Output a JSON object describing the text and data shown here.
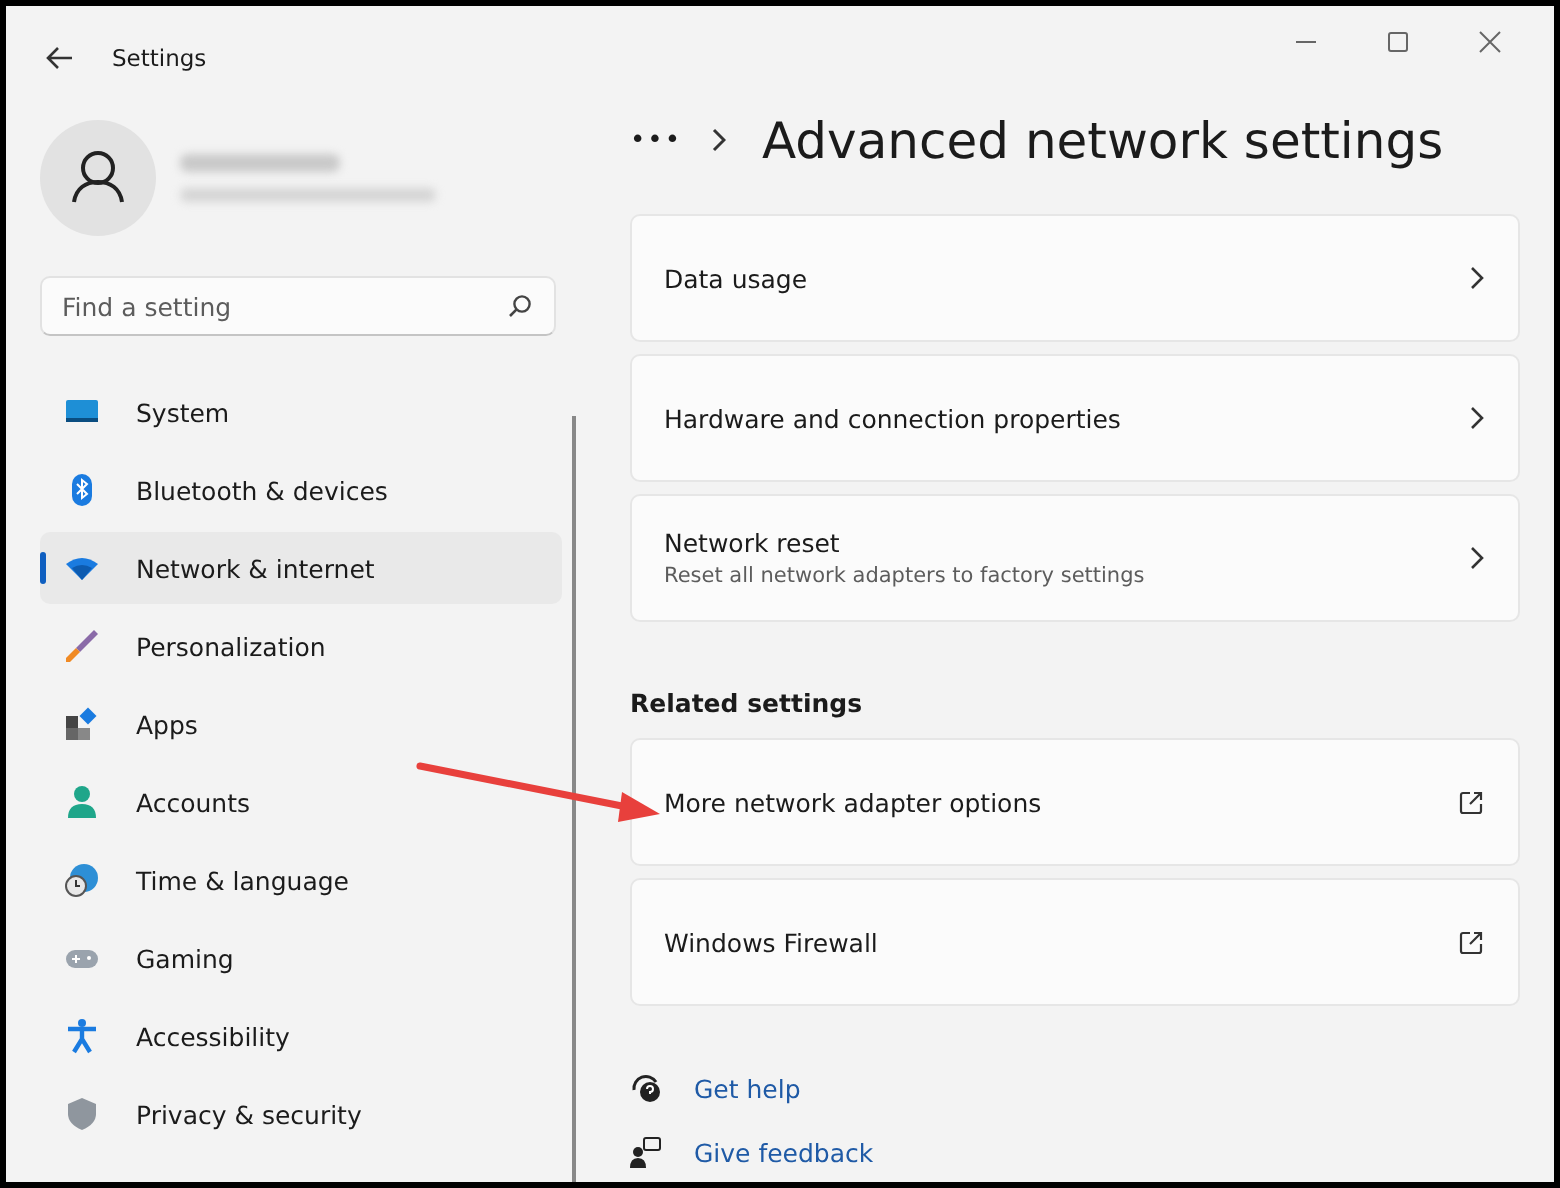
{
  "window": {
    "title": "Settings"
  },
  "search": {
    "placeholder": "Find a setting"
  },
  "sidebar": {
    "items": [
      {
        "label": "System",
        "selected": false
      },
      {
        "label": "Bluetooth & devices",
        "selected": false
      },
      {
        "label": "Network & internet",
        "selected": true
      },
      {
        "label": "Personalization",
        "selected": false
      },
      {
        "label": "Apps",
        "selected": false
      },
      {
        "label": "Accounts",
        "selected": false
      },
      {
        "label": "Time & language",
        "selected": false
      },
      {
        "label": "Gaming",
        "selected": false
      },
      {
        "label": "Accessibility",
        "selected": false
      },
      {
        "label": "Privacy & security",
        "selected": false
      }
    ]
  },
  "breadcrumb": {
    "overflow": "•••",
    "title": "Advanced network settings"
  },
  "cards": [
    {
      "title": "Data usage",
      "kind": "chevron"
    },
    {
      "title": "Hardware and connection properties",
      "kind": "chevron"
    },
    {
      "title": "Network reset",
      "subtitle": "Reset all network adapters to factory settings",
      "kind": "chevron"
    }
  ],
  "related": {
    "heading": "Related settings",
    "cards": [
      {
        "title": "More network adapter options",
        "kind": "external"
      },
      {
        "title": "Windows Firewall",
        "kind": "external"
      }
    ]
  },
  "links": [
    {
      "label": "Get help"
    },
    {
      "label": "Give feedback"
    }
  ]
}
